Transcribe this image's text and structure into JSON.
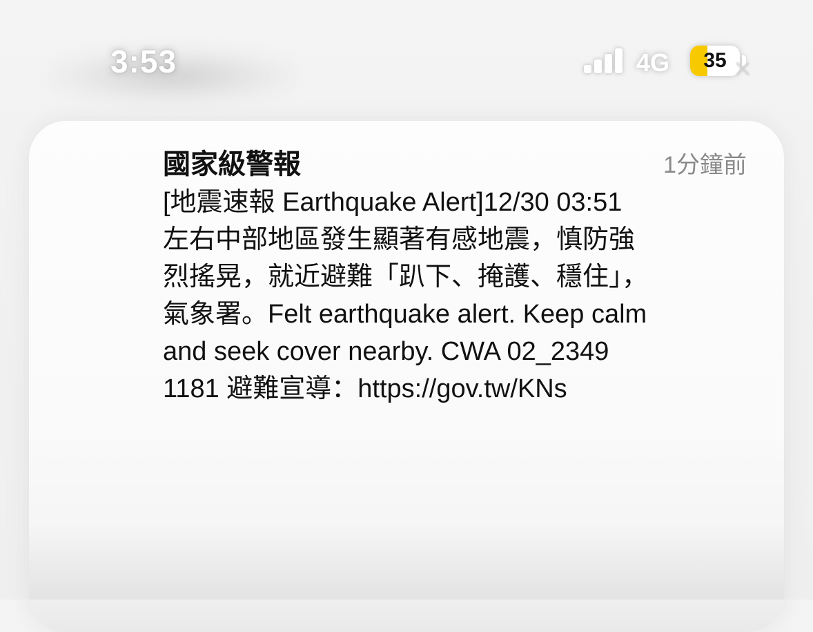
{
  "status_bar": {
    "time": "3:53",
    "network": "4G",
    "battery_level": "35",
    "battery_fraction": 0.35,
    "signal_bars": 4,
    "colors": {
      "battery_fill": "#f7c900",
      "status_text": "#ffffff"
    },
    "icons": {
      "signal": "cellular-signal-icon",
      "battery": "battery-icon",
      "dismiss": "close-icon"
    }
  },
  "notification": {
    "title": "國家級警報",
    "time_ago": "1分鐘前",
    "body_lines": [
      "[地震速報 Earthquake Alert]12/30 03:51",
      "左右中部地區發生顯著有感地震，慎防強",
      "烈搖晃，就近避難「趴下、掩護、穩住」，",
      "氣象署。Felt earthquake alert. Keep calm",
      "and seek cover nearby. CWA 02_2349",
      "1181 避難宣導：https://gov.tw/KNs"
    ]
  }
}
